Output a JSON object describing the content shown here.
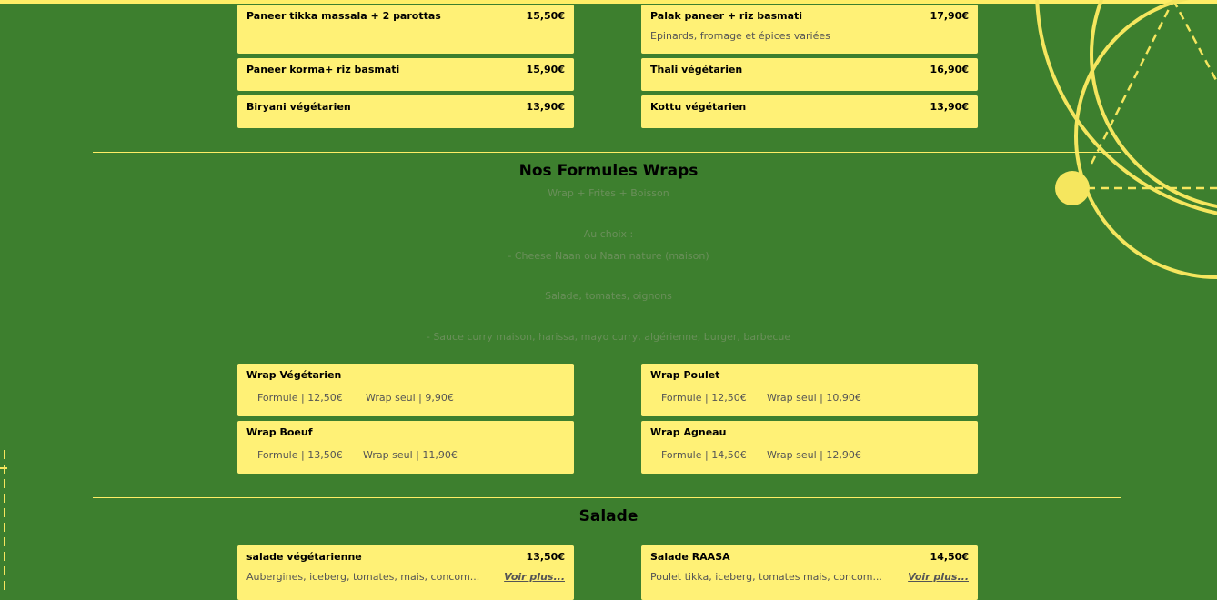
{
  "vegetarian_dishes": [
    {
      "name": "Paneer tikka massala + 2 parottas",
      "price": "15,50€",
      "desc": ""
    },
    {
      "name": "Palak paneer + riz basmati",
      "price": "17,90€",
      "desc": "Epinards, fromage et épices variées"
    },
    {
      "name": "Paneer korma+ riz basmati",
      "price": "15,90€",
      "desc": ""
    },
    {
      "name": "Thali végétarien",
      "price": "16,90€",
      "desc": ""
    },
    {
      "name": "Biryani végétarien",
      "price": "13,90€",
      "desc": ""
    },
    {
      "name": "Kottu végétarien",
      "price": "13,90€",
      "desc": ""
    }
  ],
  "wraps_section": {
    "title": "Nos Formules Wraps",
    "info_lines": [
      "Wrap + Frites + Boisson",
      "Au choix :",
      "- Cheese Naan ou Naan nature (maison)",
      "Salade, tomates, oignons",
      "- Sauce curry maison, harissa, mayo curry, algérienne, burger, barbecue"
    ],
    "items": [
      {
        "name": "Wrap Végétarien",
        "formule": "Formule | 12,50€",
        "seul": "Wrap seul | 9,90€"
      },
      {
        "name": "Wrap Poulet",
        "formule": "Formule | 12,50€",
        "seul": "Wrap seul | 10,90€"
      },
      {
        "name": "Wrap Boeuf",
        "formule": "Formule | 13,50€",
        "seul": "Wrap seul | 11,90€"
      },
      {
        "name": "Wrap Agneau",
        "formule": "Formule | 14,50€",
        "seul": "Wrap seul | 12,90€"
      }
    ]
  },
  "salade_section": {
    "title": "Salade",
    "items": [
      {
        "name": "salade végétarienne",
        "price": "13,50€",
        "desc": "Aubergines, iceberg, tomates, mais, concom...",
        "more": "Voir plus..."
      },
      {
        "name": "Salade RAASA",
        "price": "14,50€",
        "desc": "Poulet tikka, iceberg, tomates mais, concom...",
        "more": "Voir plus..."
      }
    ]
  },
  "colors": {
    "background": "#3d7f2e",
    "card": "#fff176",
    "accent": "#ffee66"
  }
}
